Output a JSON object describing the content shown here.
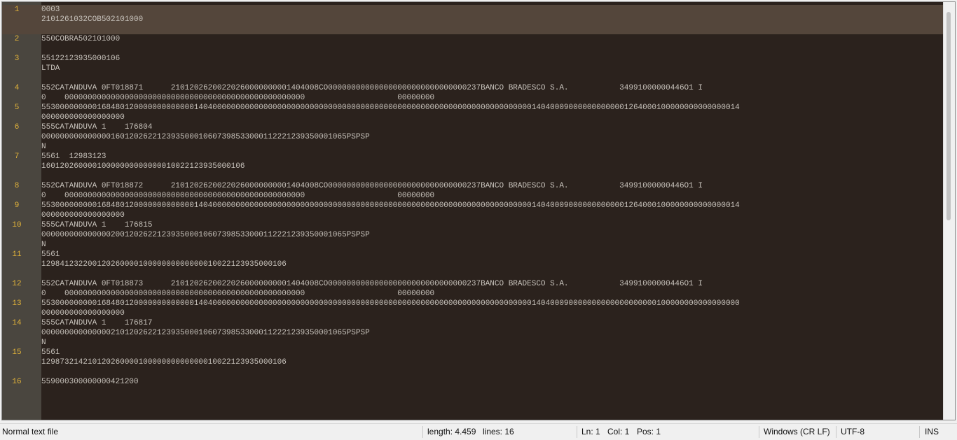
{
  "editor": {
    "lines": [
      {
        "n": "1",
        "current": true,
        "rows": [
          [
            {
              "t": "0003"
            },
            {
              "t": "                    ",
              "blur": true
            },
            {
              "t": "                  "
            },
            {
              "t": "                        ",
              "blur": true
            }
          ],
          [
            {
              "t": "2101261032COB502101000"
            }
          ]
        ]
      },
      {
        "n": "2",
        "rows": [
          [
            {
              "t": "550COBRA502101000"
            }
          ]
        ]
      },
      {
        "n": "3",
        "rows": [
          [
            {
              "t": "55122123935000106"
            },
            {
              "t": "              ",
              "blur": true
            }
          ],
          [
            {
              "t": "LTDA"
            }
          ]
        ]
      },
      {
        "n": "4",
        "rows": [
          [
            {
              "t": "552CATANDUVA 0FT018871      21012026200220260000000001404008CO000000000000000000000000000000237BANCO BRADESCO S.A.           34991000000446O1 I"
            }
          ],
          [
            {
              "t": "0    0000000000000000000000000000000000000000000000000000                    00000000"
            }
          ]
        ]
      },
      {
        "n": "5",
        "rows": [
          [
            {
              "t": "5530000000001684801200000000000001404000000000000000000000000000000000000000000000000000000000000000000000140400090000000000001264000100000000000000014"
            }
          ],
          [
            {
              "t": "000000000000000000"
            }
          ]
        ]
      },
      {
        "n": "6",
        "rows": [
          [
            {
              "t": "555CATANDUVA 1    176804"
            }
          ],
          [
            {
              "t": "000000000000000160120262212393500010607398533000112221239350001065PSPSP"
            }
          ],
          [
            {
              "t": "N"
            }
          ]
        ]
      },
      {
        "n": "7",
        "rows": [
          [
            {
              "t": "5561  12983123"
            }
          ],
          [
            {
              "t": "16012026000010000000000000010022123935000106"
            }
          ]
        ]
      },
      {
        "n": "8",
        "rows": [
          [
            {
              "t": "552CATANDUVA 0FT018872      21012026200220260000000001404008CO000000000000000000000000000000237BANCO BRADESCO S.A.           34991000000446O1 I"
            }
          ],
          [
            {
              "t": "0    0000000000000000000000000000000000000000000000000000                    00000000"
            }
          ]
        ]
      },
      {
        "n": "9",
        "rows": [
          [
            {
              "t": "5530000000001684801200000000000001404000000000000000000000000000000000000000000000000000000000000000000000140400090000000000001264000100000000000000014"
            }
          ],
          [
            {
              "t": "000000000000000000"
            }
          ]
        ]
      },
      {
        "n": "10",
        "rows": [
          [
            {
              "t": "555CATANDUVA 1    176815"
            }
          ],
          [
            {
              "t": "000000000000000200120262212393500010607398533000112221239350001065PSPSP"
            }
          ],
          [
            {
              "t": "N"
            }
          ]
        ]
      },
      {
        "n": "11",
        "rows": [
          [
            {
              "t": "5561"
            }
          ],
          [
            {
              "t": "12984123220012026000010000000000000010022123935000106"
            }
          ]
        ]
      },
      {
        "n": "12",
        "rows": [
          [
            {
              "t": "552CATANDUVA 0FT018873      21012026200220260000000001404008CO000000000000000000000000000000237BANCO BRADESCO S.A.           34991000000446O1 I"
            }
          ],
          [
            {
              "t": "0    0000000000000000000000000000000000000000000000000000                    00000000"
            }
          ]
        ]
      },
      {
        "n": "13",
        "rows": [
          [
            {
              "t": "5530000000001684801200000000000001404000000000000000000000000000000000000000000000000000000000000000000000140400090000000000000000000100000000000000000"
            }
          ],
          [
            {
              "t": "000000000000000000"
            }
          ]
        ]
      },
      {
        "n": "14",
        "rows": [
          [
            {
              "t": "555CATANDUVA 1    176817"
            }
          ],
          [
            {
              "t": "000000000000000210120262212393500010607398533000112221239350001065PSPSP"
            }
          ],
          [
            {
              "t": "N"
            }
          ]
        ]
      },
      {
        "n": "15",
        "rows": [
          [
            {
              "t": "5561"
            }
          ],
          [
            {
              "t": "12987321421012026000010000000000000010022123935000106"
            }
          ]
        ]
      },
      {
        "n": "16",
        "rows": [
          [
            {
              "t": "559000300000000421200"
            }
          ]
        ]
      }
    ]
  },
  "status": {
    "file_type": "Normal text file",
    "length": "length: 4.459",
    "lines": "lines: 16",
    "ln": "Ln: 1",
    "col": "Col: 1",
    "pos": "Pos: 1",
    "eol": "Windows (CR LF)",
    "encoding": "UTF-8",
    "mode": "INS"
  }
}
